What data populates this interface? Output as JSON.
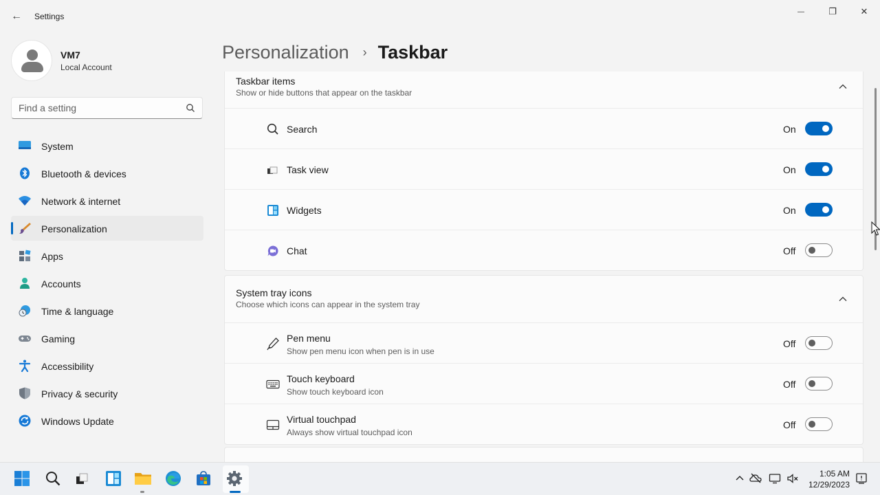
{
  "window": {
    "back_glyph": "←",
    "title": "Settings",
    "minimize_glyph": "—",
    "maximize_glyph": "❐",
    "close_glyph": "✕"
  },
  "profile": {
    "name": "VM7",
    "account_type": "Local Account"
  },
  "search": {
    "placeholder": "Find a setting",
    "value": ""
  },
  "nav": [
    {
      "label": "System",
      "icon": "system-icon"
    },
    {
      "label": "Bluetooth & devices",
      "icon": "bluetooth-icon"
    },
    {
      "label": "Network & internet",
      "icon": "wifi-icon"
    },
    {
      "label": "Personalization",
      "icon": "brush-icon",
      "active": true
    },
    {
      "label": "Apps",
      "icon": "apps-icon"
    },
    {
      "label": "Accounts",
      "icon": "accounts-icon"
    },
    {
      "label": "Time & language",
      "icon": "time-language-icon"
    },
    {
      "label": "Gaming",
      "icon": "gamepad-icon"
    },
    {
      "label": "Accessibility",
      "icon": "accessibility-icon"
    },
    {
      "label": "Privacy & security",
      "icon": "shield-icon"
    },
    {
      "label": "Windows Update",
      "icon": "windows-update-icon"
    }
  ],
  "breadcrumb": {
    "parent": "Personalization",
    "separator": "›",
    "current": "Taskbar"
  },
  "taskbar_items": {
    "title": "Taskbar items",
    "subtitle": "Show or hide buttons that appear on the taskbar",
    "rows": [
      {
        "label": "Search",
        "state": "On",
        "on": true,
        "icon": "search-icon"
      },
      {
        "label": "Task view",
        "state": "On",
        "on": true,
        "icon": "task-view-icon"
      },
      {
        "label": "Widgets",
        "state": "On",
        "on": true,
        "icon": "widgets-icon"
      },
      {
        "label": "Chat",
        "state": "Off",
        "on": false,
        "icon": "chat-icon"
      }
    ]
  },
  "system_tray": {
    "title": "System tray icons",
    "subtitle": "Choose which icons can appear in the system tray",
    "rows": [
      {
        "label": "Pen menu",
        "sub": "Show pen menu icon when pen is in use",
        "state": "Off",
        "on": false,
        "icon": "pen-icon"
      },
      {
        "label": "Touch keyboard",
        "sub": "Show touch keyboard icon",
        "state": "Off",
        "on": false,
        "icon": "keyboard-icon"
      },
      {
        "label": "Virtual touchpad",
        "sub": "Always show virtual touchpad icon",
        "state": "Off",
        "on": false,
        "icon": "touchpad-icon"
      }
    ]
  },
  "clock": {
    "time": "1:05 AM",
    "date": "12/29/2023"
  },
  "colors": {
    "accent": "#0067c0",
    "background": "#f3f3f3",
    "card": "#fbfbfb"
  }
}
